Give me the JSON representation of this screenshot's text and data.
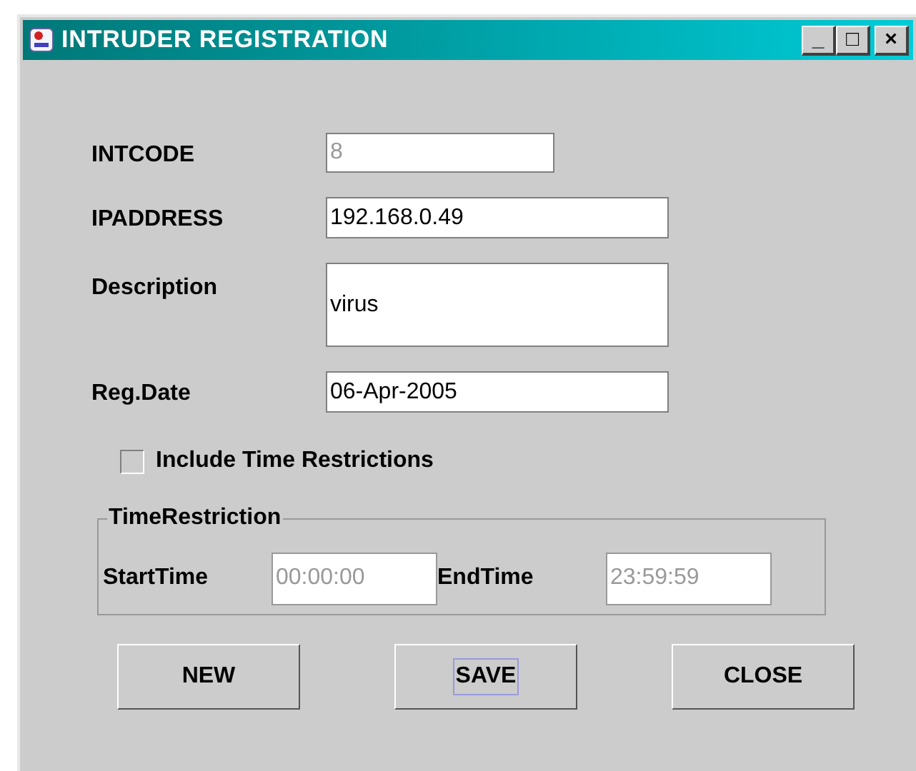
{
  "window": {
    "title": "INTRUDER REGISTRATION",
    "controls": [
      "_",
      "□",
      "×"
    ]
  },
  "fields": [
    {
      "label": "INTCODE",
      "value": "8",
      "disabled": true,
      "kind": "short"
    },
    {
      "label": "IPADDRESS",
      "value": "192.168.0.49",
      "disabled": false,
      "kind": "line"
    },
    {
      "label": "Description",
      "value": "virus",
      "disabled": false,
      "kind": "area"
    },
    {
      "label": "Reg.Date",
      "value": "06-Apr-2005",
      "disabled": false,
      "kind": "line"
    }
  ],
  "checkbox": {
    "label": "Include Time Restrictions",
    "checked": false
  },
  "group": {
    "title": "TimeRestriction",
    "fields": [
      {
        "label": "StartTime",
        "value": "00:00:00",
        "disabled": true
      },
      {
        "label": "EndTime",
        "value": "23:59:59",
        "disabled": true
      }
    ]
  },
  "buttons": [
    {
      "label": "NEW",
      "focused": false
    },
    {
      "label": "SAVE",
      "focused": true
    },
    {
      "label": "CLOSE",
      "focused": false
    }
  ]
}
